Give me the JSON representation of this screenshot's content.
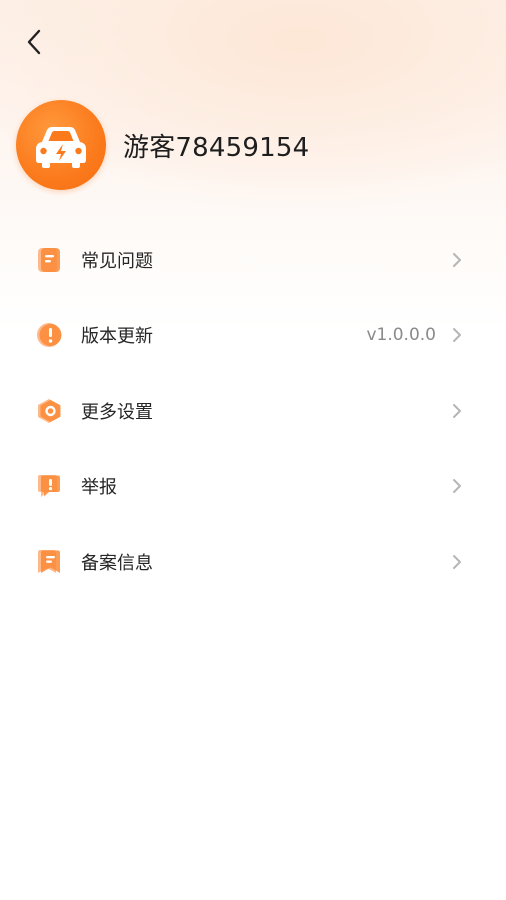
{
  "header": {
    "back_icon": "chevron-left-icon"
  },
  "profile": {
    "avatar_icon": "car-bolt-icon",
    "username": "游客78459154"
  },
  "colors": {
    "accent": "#fb7a1c",
    "accent_light": "#fdb98a",
    "text": "#262626",
    "secondary_text": "#8a8a8a",
    "chevron": "#b5b5b5"
  },
  "menu": {
    "items": [
      {
        "label": "常见问题",
        "icon": "document-icon",
        "value": ""
      },
      {
        "label": "版本更新",
        "icon": "exclamation-circle-icon",
        "value": "v1.0.0.0"
      },
      {
        "label": "更多设置",
        "icon": "hexagon-settings-icon",
        "value": ""
      },
      {
        "label": "举报",
        "icon": "report-flag-icon",
        "value": ""
      },
      {
        "label": "备案信息",
        "icon": "record-badge-icon",
        "value": ""
      }
    ]
  }
}
